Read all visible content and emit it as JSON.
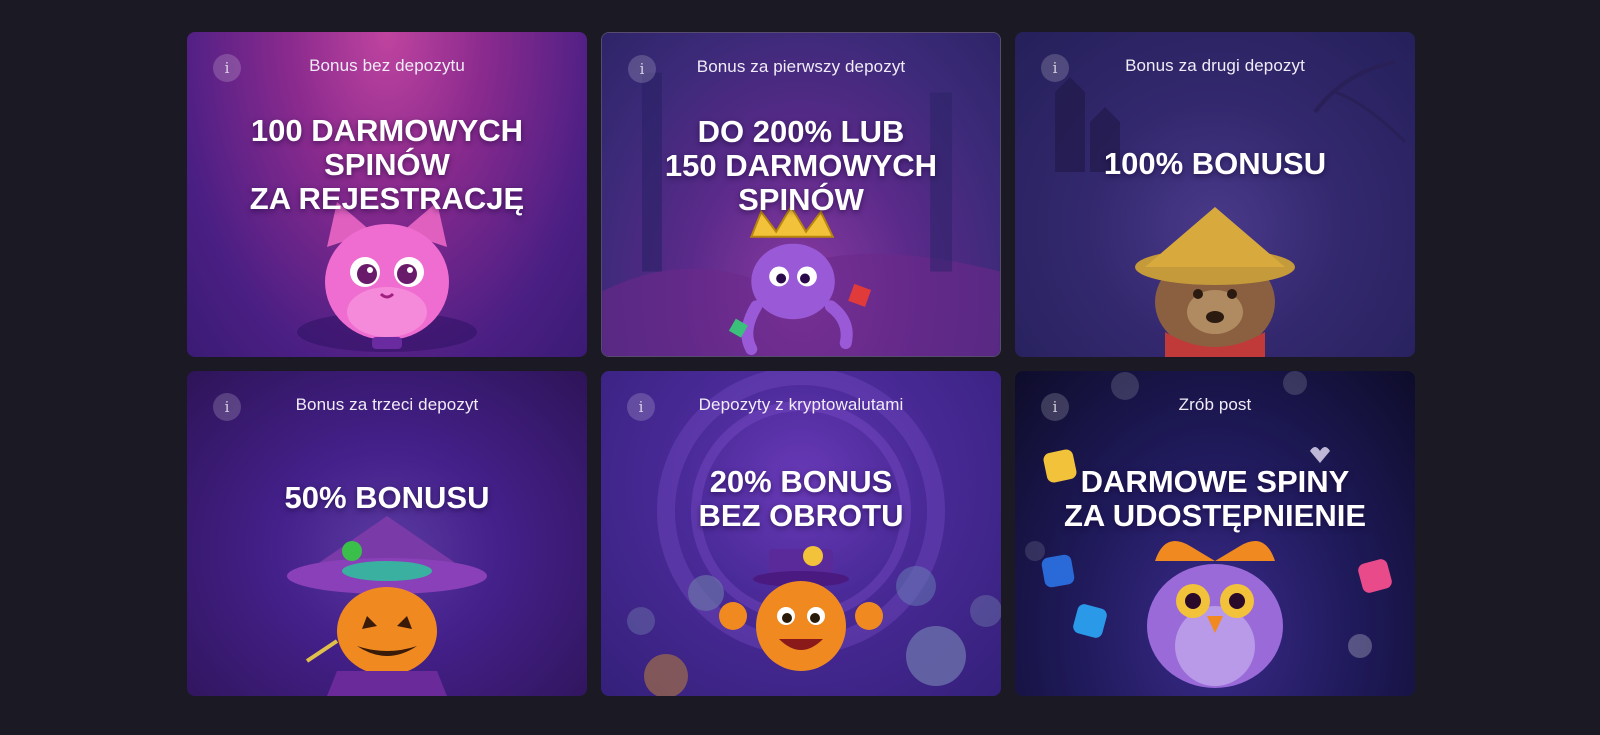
{
  "cards": [
    {
      "label": "Bonus bez depozytu",
      "headline": [
        "100 DARMOWYCH",
        "SPINÓW",
        "ZA REJESTRACJĘ"
      ],
      "character": "pink-cat",
      "bg": [
        "#b03a9e",
        "#6a2386",
        "#3b1a7a"
      ]
    },
    {
      "label": "Bonus za pierwszy depozyt",
      "headline": [
        "DO 200% LUB",
        "150 DARMOWYCH",
        "SPINÓW"
      ],
      "character": "crowned-octopus",
      "bg": [
        "#3b2a7a",
        "#5a2a86",
        "#3a1a6a"
      ]
    },
    {
      "label": "Bonus za drugi depozyt",
      "headline": [
        "100% BONUSU"
      ],
      "character": "dog-with-straw-hat",
      "bg": [
        "#2a2566",
        "#3a2a78",
        "#2a1f5e"
      ]
    },
    {
      "label": "Bonus za trzeci depozyt",
      "headline": [
        "50% BONUSU"
      ],
      "character": "pumpkin-wizard",
      "bg": [
        "#3a1a66",
        "#4a1f70",
        "#2c1350"
      ]
    },
    {
      "label": "Depozyty z kryptowalutami",
      "headline": [
        "20% BONUS",
        "BEZ OBROTU"
      ],
      "character": "orange-with-top-hat",
      "bg": [
        "#3a1f7a",
        "#5a2aa0",
        "#3a1f78"
      ]
    },
    {
      "label": "Zrób post",
      "headline": [
        "DARMOWE SPINY",
        "ZA UDOSTĘPNIENIE"
      ],
      "character": "purple-owl",
      "bg": [
        "#0e0c2a",
        "#1f1a5a",
        "#2a1f6e"
      ]
    }
  ],
  "info_icon": "info-icon",
  "colors": {
    "page_bg": "#1b1a24",
    "text": "#ffffff"
  }
}
